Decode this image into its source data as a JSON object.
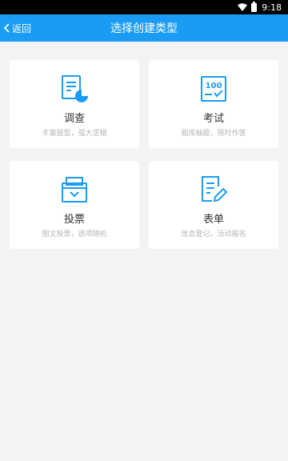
{
  "status_bar": {
    "time": "9:18"
  },
  "header": {
    "back_label": "返回",
    "title": "选择创建类型"
  },
  "types": [
    {
      "name": "调查",
      "desc": "丰富题型，强大逻辑",
      "icon": "survey-chart-icon"
    },
    {
      "name": "考试",
      "desc": "题库抽题，限时作答",
      "icon": "exam-100-icon"
    },
    {
      "name": "投票",
      "desc": "图文投票，选项随机",
      "icon": "ballot-box-icon"
    },
    {
      "name": "表单",
      "desc": "信息登记，活动报名",
      "icon": "form-edit-icon"
    }
  ],
  "colors": {
    "accent": "#1a9cf5",
    "background": "#f2f3f5"
  }
}
